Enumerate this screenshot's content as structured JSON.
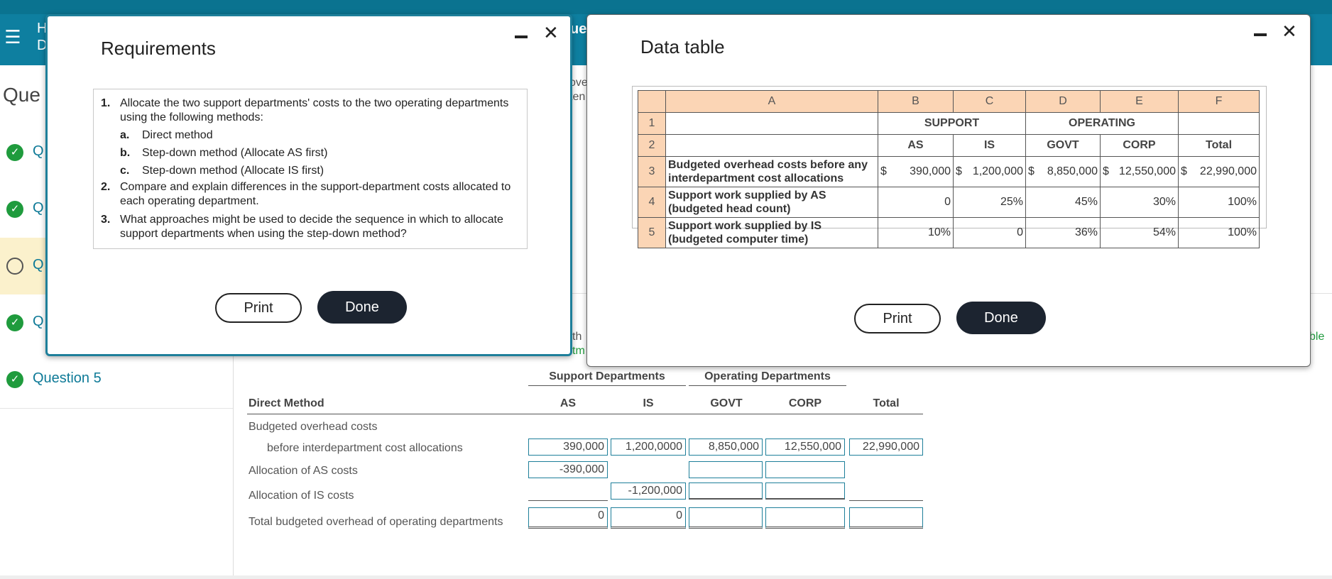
{
  "background": {
    "header_text": "H\nD",
    "que_title": "Que",
    "questions": [
      {
        "label": "Q",
        "status": "done"
      },
      {
        "label": "Q",
        "status": "done"
      },
      {
        "label": "Q",
        "status": "current"
      },
      {
        "label": "Q",
        "status": "done"
      },
      {
        "label": "Question 5",
        "status": "done"
      }
    ],
    "frag_ue": "ue",
    "frag_ove": "ove",
    "frag_ten": "ten",
    "frag_th": "th",
    "frag_tm": "tm",
    "frag_ble": "ble"
  },
  "worksheet": {
    "group_support": "Support Departments",
    "group_operating": "Operating Departments",
    "method_label": "Direct Method",
    "columns": [
      "AS",
      "IS",
      "GOVT",
      "CORP",
      "Total"
    ],
    "row_labels": {
      "budgeted": "Budgeted overhead costs",
      "before": "before interdepartment cost allocations",
      "alloc_as": "Allocation of AS costs",
      "alloc_is": "Allocation of IS costs",
      "total": "Total budgeted overhead of operating departments"
    },
    "values": {
      "before": [
        "390,000",
        "1,200,0000",
        "8,850,000",
        "12,550,000",
        "22,990,000"
      ],
      "alloc_as": [
        "-390,000",
        "",
        "",
        ""
      ],
      "alloc_is": [
        "-1,200,000",
        "",
        ""
      ],
      "total": [
        "0",
        "0",
        "",
        "",
        ""
      ]
    }
  },
  "requirements_modal": {
    "title": "Requirements",
    "items": [
      {
        "num": "1.",
        "lines": [
          "Allocate the two support departments' costs to the two operating departments",
          "using the following methods:"
        ]
      },
      {
        "num": "a.",
        "lines": [
          "Direct method"
        ]
      },
      {
        "num": "b.",
        "lines": [
          "Step-down method (Allocate AS first)"
        ]
      },
      {
        "num": "c.",
        "lines": [
          "Step-down method (Allocate IS first)"
        ]
      },
      {
        "num": "2.",
        "lines": [
          "Compare and explain differences in the support-department costs allocated to",
          "each operating department."
        ]
      },
      {
        "num": "3.",
        "lines": [
          "What approaches might be used to decide the sequence in which to allocate",
          "support departments when using the step-down method?"
        ]
      }
    ],
    "print_label": "Print",
    "done_label": "Done"
  },
  "data_modal": {
    "title": "Data table",
    "col_letters": [
      "A",
      "B",
      "C",
      "D",
      "E",
      "F"
    ],
    "row_numbers": [
      "1",
      "2",
      "3",
      "4",
      "5"
    ],
    "group_support": "SUPPORT",
    "group_operating": "OPERATING",
    "headers": [
      "AS",
      "IS",
      "GOVT",
      "CORP",
      "Total"
    ],
    "rows": [
      {
        "label": [
          "Budgeted overhead costs before any",
          "interdepartment cost allocations"
        ],
        "values": [
          "390,000",
          "1,200,000",
          "8,850,000",
          "12,550,000",
          "22,990,000"
        ],
        "dollar": "$"
      },
      {
        "label": [
          "Support work supplied by AS",
          "(budgeted head count)"
        ],
        "values": [
          "0",
          "25%",
          "45%",
          "30%",
          "100%"
        ]
      },
      {
        "label": [
          "Support work supplied by IS",
          "(budgeted computer time)"
        ],
        "values": [
          "10%",
          "0",
          "36%",
          "54%",
          "100%"
        ]
      }
    ],
    "print_label": "Print",
    "done_label": "Done"
  },
  "icons": {
    "menu": "hamburger-icon",
    "check": "check-circle-icon",
    "open": "empty-circle-icon",
    "minimize": "minimize-icon",
    "close": "close-icon"
  },
  "colors": {
    "header": "#0e7fa0",
    "accent_green": "#1f9b3d",
    "table_header": "#fbd5b5",
    "done_button": "#1c2430"
  }
}
